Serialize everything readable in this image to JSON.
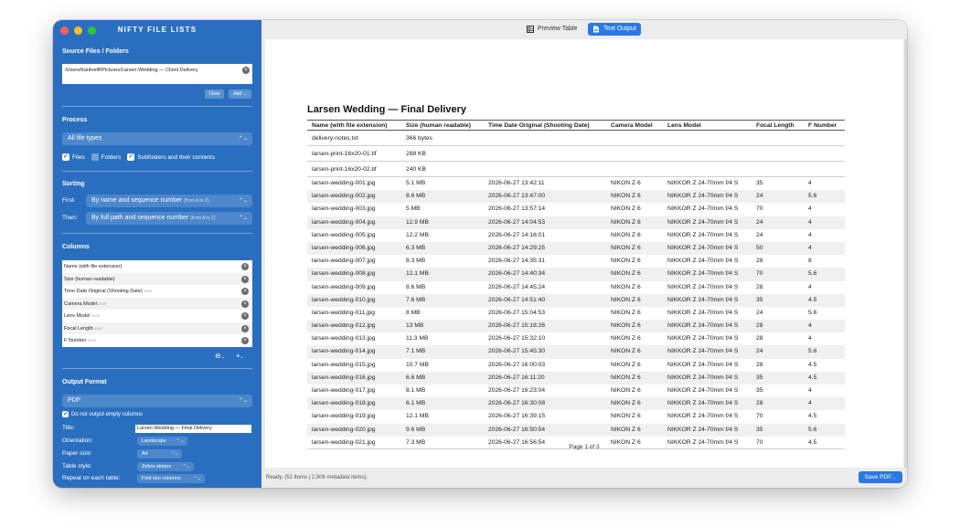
{
  "app": {
    "title": "NIFTY FILE LISTS"
  },
  "colors": {
    "sidebar_bg": "#2a6fbf",
    "accent": "#2a79e2",
    "close": "#ff5f57",
    "minimize": "#febc2e",
    "zoom": "#28c840"
  },
  "source": {
    "title": "Source Files / Folders",
    "path": "/Users/frankreiff/Pictures/Larsen Wedding — Client Delivery",
    "clear_label": "Clear",
    "add_label": "Add ..."
  },
  "process": {
    "title": "Process",
    "file_types": "All file types",
    "files_label": "Files",
    "files_checked": true,
    "folders_label": "Folders",
    "folders_checked": false,
    "subfolders_label": "Subfolders and their contents",
    "subfolders_checked": true
  },
  "sorting": {
    "title": "Sorting",
    "first_label": "First:",
    "first_value": "By name and sequence number",
    "first_hint": "(from A to Z)",
    "then_label": "Then:",
    "then_value": "By full path and sequence number",
    "then_hint": "(from A to Z)"
  },
  "columns": {
    "title": "Columns",
    "items": [
      {
        "label": "Name (with file extension)",
        "tag": ""
      },
      {
        "label": "Size (human readable)",
        "tag": ""
      },
      {
        "label": "Time Date Original (Shooting Date)",
        "tag": "EXIF"
      },
      {
        "label": "Camera Model",
        "tag": "EXIF"
      },
      {
        "label": "Lens Model",
        "tag": "EXIF"
      },
      {
        "label": "Focal Length",
        "tag": "EXIF"
      },
      {
        "label": "F Number",
        "tag": "EXIF"
      }
    ],
    "remove_icon": "minus-circle-icon",
    "add_icon": "plus-icon"
  },
  "output": {
    "title": "Output Format",
    "format": "PDF",
    "skip_empty_label": "Do not output empty columns",
    "skip_empty_checked": true,
    "title_label": "Title:",
    "title_value": "Larsen Wedding — Final Delivery",
    "orientation_label": "Orientation:",
    "orientation_value": "Landscape",
    "paper_label": "Paper size:",
    "paper_value": "A4",
    "style_label": "Table style:",
    "style_value": "Zebra stripes",
    "repeat_label": "Repeat on each table:",
    "repeat_value": "First two columns"
  },
  "toolbar": {
    "preview_table_label": "Preview Table",
    "text_output_label": "Text Output"
  },
  "document": {
    "title": "Larsen Wedding — Final Delivery",
    "headers": [
      "Name (with file extension)",
      "Size (human readable)",
      "Time Date Original (Shooting Date)",
      "Camera Model",
      "Lens Model",
      "Focal Length",
      "F Number"
    ],
    "rows": [
      [
        "delivery-notes.txt",
        "366 bytes",
        "",
        "",
        "",
        "",
        ""
      ],
      [
        "larsen-print-16x20-01.tif",
        "288 KB",
        "",
        "",
        "",
        "",
        ""
      ],
      [
        "larsen-print-16x20-02.tif",
        "240 KB",
        "",
        "",
        "",
        "",
        ""
      ],
      [
        "larsen-wedding-001.jpg",
        "5.1 MB",
        "2026-06-27 13:42:11",
        "NIKON Z 6",
        "NIKKOR Z 24-70mm f/4 S",
        "35",
        "4"
      ],
      [
        "larsen-wedding-002.jpg",
        "8.6 MB",
        "2026-06-27 13:47:00",
        "NIKON Z 6",
        "NIKKOR Z 24-70mm f/4 S",
        "24",
        "5.6"
      ],
      [
        "larsen-wedding-003.jpg",
        "5 MB",
        "2026-06-27 13:57:14",
        "NIKON Z 6",
        "NIKKOR Z 24-70mm f/4 S",
        "70",
        "4"
      ],
      [
        "larsen-wedding-004.jpg",
        "12.9 MB",
        "2026-06-27 14:04:53",
        "NIKON Z 6",
        "NIKKOR Z 24-70mm f/4 S",
        "24",
        "4"
      ],
      [
        "larsen-wedding-005.jpg",
        "12.2 MB",
        "2026-06-27 14:16:01",
        "NIKON Z 6",
        "NIKKOR Z 24-70mm f/4 S",
        "24",
        "4"
      ],
      [
        "larsen-wedding-006.jpg",
        "6.3 MB",
        "2026-06-27 14:29:25",
        "NIKON Z 6",
        "NIKKOR Z 24-70mm f/4 S",
        "50",
        "4"
      ],
      [
        "larsen-wedding-007.jpg",
        "8.3 MB",
        "2026-06-27 14:35:31",
        "NIKON Z 6",
        "NIKKOR Z 24-70mm f/4 S",
        "28",
        "8"
      ],
      [
        "larsen-wedding-008.jpg",
        "12.1 MB",
        "2026-06-27 14:40:34",
        "NIKON Z 6",
        "NIKKOR Z 24-70mm f/4 S",
        "70",
        "5.6"
      ],
      [
        "larsen-wedding-009.jpg",
        "8.6 MB",
        "2026-06-27 14:45:24",
        "NIKON Z 6",
        "NIKKOR Z 24-70mm f/4 S",
        "28",
        "4"
      ],
      [
        "larsen-wedding-010.jpg",
        "7.6 MB",
        "2026-06-27 14:51:40",
        "NIKON Z 6",
        "NIKKOR Z 24-70mm f/4 S",
        "35",
        "4.5"
      ],
      [
        "larsen-wedding-011.jpg",
        "8 MB",
        "2026-06-27 15:04:53",
        "NIKON Z 6",
        "NIKKOR Z 24-70mm f/4 S",
        "24",
        "5.6"
      ],
      [
        "larsen-wedding-012.jpg",
        "13 MB",
        "2026-06-27 15:18:26",
        "NIKON Z 6",
        "NIKKOR Z 24-70mm f/4 S",
        "28",
        "4"
      ],
      [
        "larsen-wedding-013.jpg",
        "11.3 MB",
        "2026-06-27 15:32:10",
        "NIKON Z 6",
        "NIKKOR Z 24-70mm f/4 S",
        "28",
        "4"
      ],
      [
        "larsen-wedding-014.jpg",
        "7.1 MB",
        "2026-06-27 15:45:30",
        "NIKON Z 6",
        "NIKKOR Z 24-70mm f/4 S",
        "24",
        "5.6"
      ],
      [
        "larsen-wedding-015.jpg",
        "10.7 MB",
        "2026-06-27 16:00:03",
        "NIKON Z 6",
        "NIKKOR Z 24-70mm f/4 S",
        "28",
        "4.5"
      ],
      [
        "larsen-wedding-016.jpg",
        "6.6 MB",
        "2026-06-27 16:11:20",
        "NIKON Z 6",
        "NIKKOR Z 24-70mm f/4 S",
        "35",
        "4.5"
      ],
      [
        "larsen-wedding-017.jpg",
        "8.1 MB",
        "2026-06-27 16:23:04",
        "NIKON Z 6",
        "NIKKOR Z 24-70mm f/4 S",
        "35",
        "4"
      ],
      [
        "larsen-wedding-018.jpg",
        "6.1 MB",
        "2026-06-27 16:30:08",
        "NIKON Z 6",
        "NIKKOR Z 24-70mm f/4 S",
        "28",
        "4"
      ],
      [
        "larsen-wedding-019.jpg",
        "12.1 MB",
        "2026-06-27 16:39:15",
        "NIKON Z 6",
        "NIKKOR Z 24-70mm f/4 S",
        "70",
        "4.5"
      ],
      [
        "larsen-wedding-020.jpg",
        "9.6 MB",
        "2026-06-27 16:50:54",
        "NIKON Z 6",
        "NIKKOR Z 24-70mm f/4 S",
        "35",
        "5.6"
      ],
      [
        "larsen-wedding-021.jpg",
        "7.3 MB",
        "2026-06-27 16:56:54",
        "NIKON Z 6",
        "NIKKOR Z 24-70mm f/4 S",
        "70",
        "4.5"
      ]
    ],
    "page_label": "Page 1 of 3"
  },
  "status": {
    "text": "Ready. (52 items | 2,506 metadata items).",
    "save_label": "Save PDF..."
  }
}
